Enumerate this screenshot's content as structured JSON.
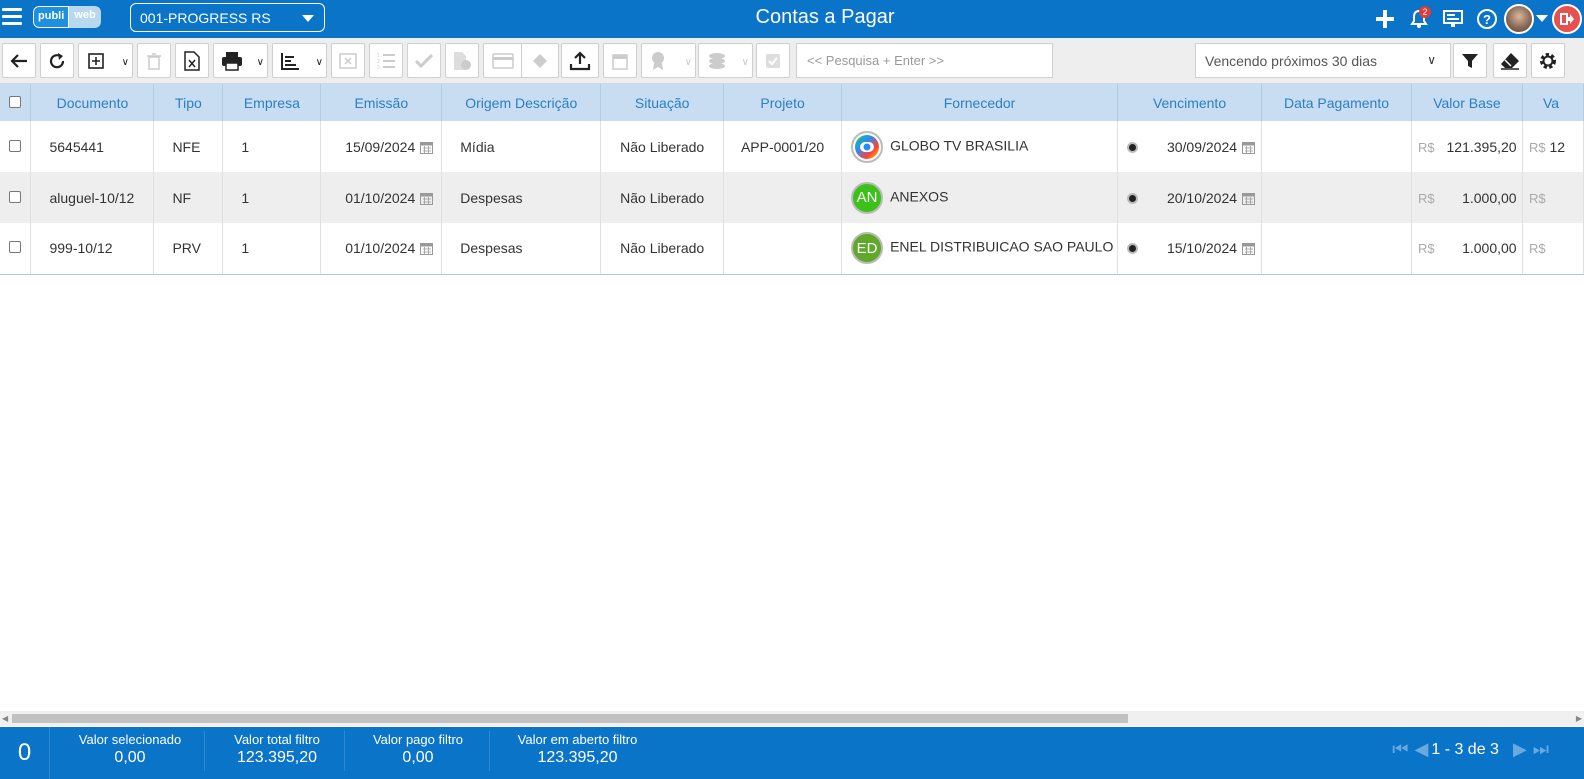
{
  "header": {
    "logo_part1": "publi",
    "logo_part2": "web",
    "company": "001-PROGRESS RS",
    "title": "Contas a Pagar",
    "notifications_count": "2"
  },
  "toolbar": {
    "search_placeholder": "<< Pesquisa + Enter >>",
    "period": "Vencendo próximos 30 dias"
  },
  "table": {
    "columns": [
      "Documento",
      "Tipo",
      "Empresa",
      "Emissão",
      "Origem Descrição",
      "Situação",
      "Projeto",
      "Fornecedor",
      "Vencimento",
      "Data Pagamento",
      "Valor Base",
      "Va"
    ],
    "currency": "R$",
    "rows": [
      {
        "documento": "5645441",
        "tipo": "NFE",
        "empresa": "1",
        "emissao": "15/09/2024",
        "origem": "Mídia",
        "situacao": "Não Liberado",
        "projeto": "APP-0001/20",
        "fornecedor": "GLOBO TV BRASILIA",
        "avatar": "",
        "avatar_color": "#ffffff",
        "vencimento": "30/09/2024",
        "data_pagamento": "",
        "valor_base": "121.395,20",
        "valor_next": "12"
      },
      {
        "documento": "aluguel-10/12",
        "tipo": "NF",
        "empresa": "1",
        "emissao": "01/10/2024",
        "origem": "Despesas",
        "situacao": "Não Liberado",
        "projeto": "",
        "fornecedor": "ANEXOS",
        "avatar": "AN",
        "avatar_color": "#3cc01a",
        "vencimento": "20/10/2024",
        "data_pagamento": "",
        "valor_base": "1.000,00",
        "valor_next": ""
      },
      {
        "documento": "999-10/12",
        "tipo": "PRV",
        "empresa": "1",
        "emissao": "01/10/2024",
        "origem": "Despesas",
        "situacao": "Não Liberado",
        "projeto": "",
        "fornecedor": "ENEL DISTRIBUICAO SAO PAULO",
        "avatar": "ED",
        "avatar_color": "#5fa82a",
        "vencimento": "15/10/2024",
        "data_pagamento": "",
        "valor_base": "1.000,00",
        "valor_next": ""
      }
    ]
  },
  "footer": {
    "selected_count": "0",
    "valor_selecionado_label": "Valor selecionado",
    "valor_selecionado": "0,00",
    "valor_total_label": "Valor total filtro",
    "valor_total": "123.395,20",
    "valor_pago_label": "Valor pago filtro",
    "valor_pago": "0,00",
    "valor_aberto_label": "Valor em aberto filtro",
    "valor_aberto": "123.395,20",
    "pagination": "1 - 3 de 3"
  },
  "colors": {
    "primary": "#0a74c9",
    "header_row": "#c8ddf1",
    "header_text": "#2a7fc5"
  }
}
